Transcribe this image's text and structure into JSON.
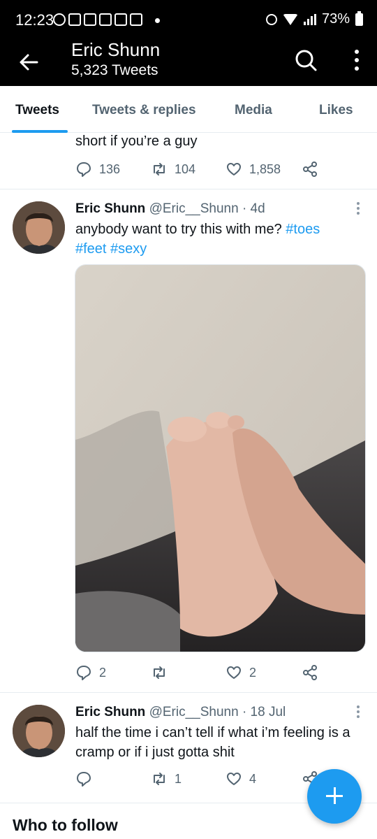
{
  "status": {
    "time": "12:23",
    "battery": "73%"
  },
  "header": {
    "name": "Eric Shunn",
    "tweet_count": "5,323 Tweets"
  },
  "tabs": [
    "Tweets",
    "Tweets & replies",
    "Media",
    "Likes"
  ],
  "tweet0": {
    "text_tail": "short if you’re a guy",
    "replies": "136",
    "retweets": "104",
    "likes": "1,858"
  },
  "tweet1": {
    "author": "Eric Shunn",
    "handle": "@Eric__Shunn",
    "time": "· 4d",
    "text": "anybody want to try this with me?",
    "tags": [
      "#toes",
      "#feet",
      "#sexy"
    ],
    "replies": "2",
    "retweets": "",
    "likes": "2"
  },
  "tweet2": {
    "author": "Eric Shunn",
    "handle": "@Eric__Shunn",
    "time": "· 18 Jul",
    "text": "half the time i can’t tell if what i’m feeling is a cramp or if i just gotta shit",
    "replies": "",
    "retweets": "1",
    "likes": "4"
  },
  "section": {
    "who_to_follow": "Who to follow"
  },
  "colors": {
    "accent": "#1d9bf0",
    "muted": "#536471",
    "header_bg": "#000000"
  },
  "icons": [
    "back-arrow-icon",
    "search-icon",
    "more-vertical-icon",
    "reply-icon",
    "retweet-icon",
    "like-icon",
    "share-icon",
    "compose-icon"
  ]
}
